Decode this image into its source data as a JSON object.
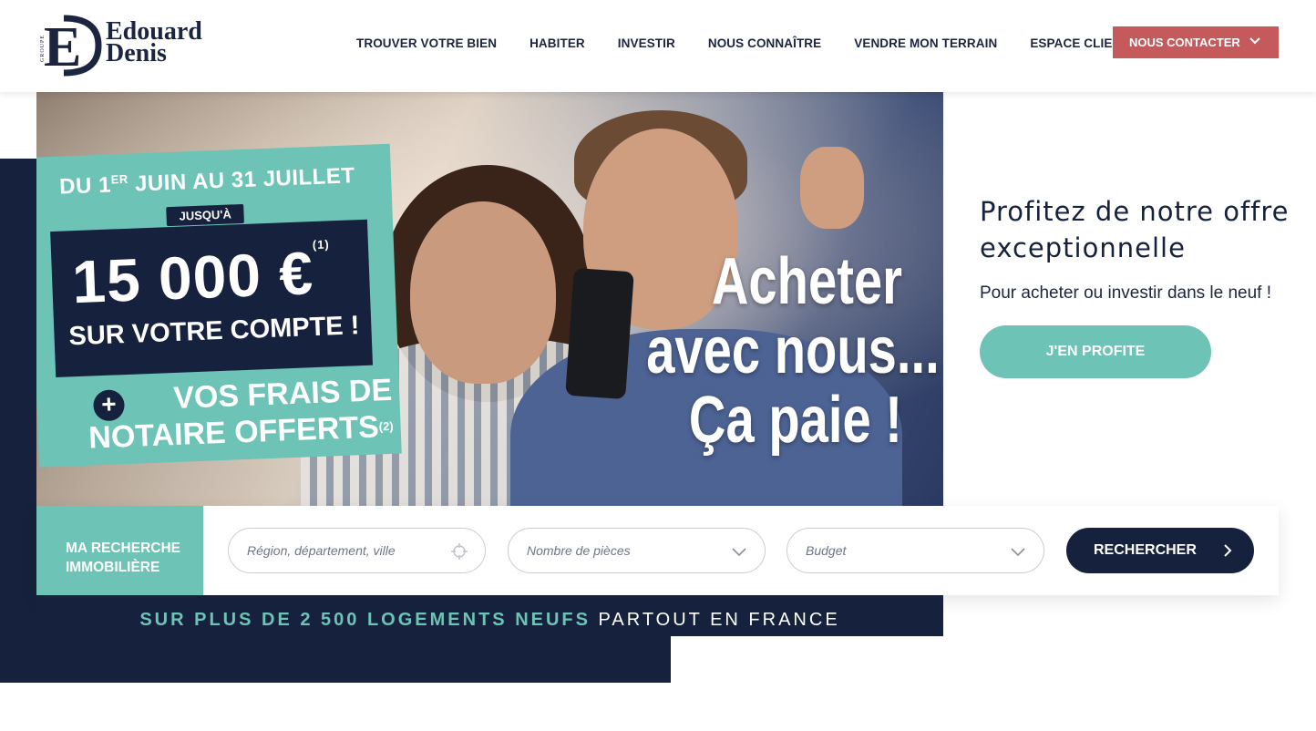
{
  "brand": {
    "group_label": "GROUPE",
    "monogram": "ED",
    "name_line1": "Edouard",
    "name_line2": "Denis"
  },
  "nav": {
    "items": [
      {
        "label": "TROUVER VOTRE BIEN"
      },
      {
        "label": "HABITER"
      },
      {
        "label": "INVESTIR"
      },
      {
        "label": "NOUS CONNAÎTRE"
      },
      {
        "label": "VENDRE MON TERRAIN"
      },
      {
        "label": "ESPACE CLIENT"
      }
    ],
    "contact_label": "NOUS CONTACTER"
  },
  "hero": {
    "promo": {
      "dates_prefix": "DU 1",
      "dates_sup": "ER",
      "dates_suffix": " JUIN AU 31 JUILLET",
      "upto": "JUSQU'À",
      "amount": "15 000 €",
      "amount_note": "(1)",
      "account": "SUR VOTRE COMPTE !",
      "plus": "+",
      "notary": "VOS FRAIS DE\nNOTAIRE OFFERTS",
      "notary_note": "(2)"
    },
    "slogan": {
      "line1": "Acheter",
      "line2": "avec nous...",
      "line3": "Ça paie !"
    }
  },
  "offer": {
    "title": "Profitez de notre offre exceptionnelle",
    "subtitle": "Pour acheter ou investir dans le neuf !",
    "cta_label": "J'EN PROFITE"
  },
  "search": {
    "label": "MA RECHERCHE\nIMMOBILIÈRE",
    "location_placeholder": "Région, département, ville",
    "rooms_placeholder": "Nombre de pièces",
    "budget_placeholder": "Budget",
    "button_label": "RECHERCHER"
  },
  "tagline": {
    "highlight": "SUR PLUS DE 2 500 LOGEMENTS NEUFS",
    "rest": " PARTOUT EN FRANCE"
  },
  "colors": {
    "navy": "#16223d",
    "teal": "#6cc3b6",
    "contact_red": "#c45a5c"
  }
}
